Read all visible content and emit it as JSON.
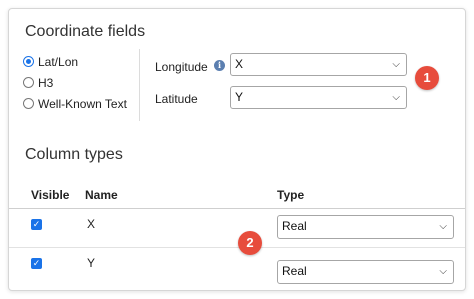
{
  "coordinate_fields": {
    "title": "Coordinate fields",
    "options": [
      {
        "label": "Lat/Lon",
        "checked": true
      },
      {
        "label": "H3",
        "checked": false
      },
      {
        "label": "Well-Known Text",
        "checked": false
      }
    ],
    "longitude_label": "Longitude",
    "longitude_value": "X",
    "latitude_label": "Latitude",
    "latitude_value": "Y",
    "info_icon": "i"
  },
  "column_types": {
    "title": "Column types",
    "headers": {
      "visible": "Visible",
      "name": "Name",
      "type": "Type"
    },
    "rows": [
      {
        "name": "X",
        "visible": true,
        "type": "Real"
      },
      {
        "name": "Y",
        "visible": true,
        "type": "Real"
      }
    ]
  },
  "badges": {
    "one": "1",
    "two": "2"
  },
  "colors": {
    "accent": "#1a73e8",
    "badge": "#e74c3c"
  }
}
